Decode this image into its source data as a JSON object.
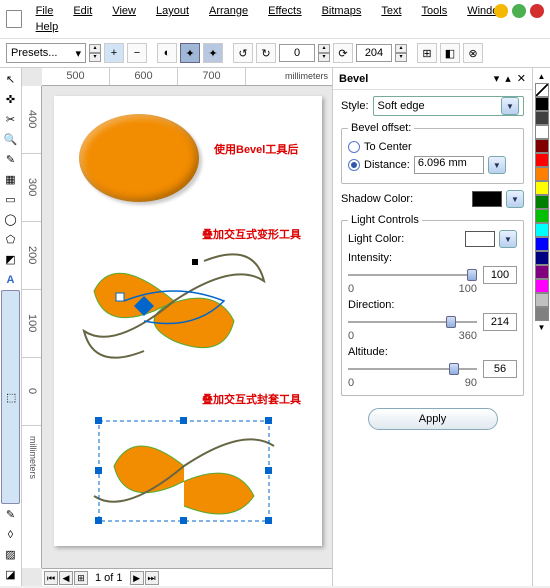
{
  "menu": {
    "items": [
      "File",
      "Edit",
      "View",
      "Layout",
      "Arrange",
      "Effects",
      "Bitmaps",
      "Text",
      "Tools",
      "Window",
      "Help"
    ]
  },
  "toolbar": {
    "presets": "Presets...",
    "rot": "0",
    "copies": "204"
  },
  "ruler": {
    "h": [
      "500",
      "600",
      "700"
    ],
    "v": [
      "400",
      "300",
      "200",
      "100",
      "0"
    ],
    "units": "millimeters",
    "vunits": "millimeters"
  },
  "annot": {
    "a1": "使用Bevel工具后",
    "a2": "叠加交互式变形工具",
    "a3": "叠加交互式封套工具"
  },
  "pagebar": {
    "label": "1 of 1"
  },
  "bevel": {
    "title": "Bevel",
    "style_lbl": "Style:",
    "style_val": "Soft edge",
    "offset_lbl": "Bevel offset:",
    "to_center": "To Center",
    "distance_lbl": "Distance:",
    "distance_val": "6.096 mm",
    "shadow_lbl": "Shadow Color:",
    "light_legend": "Light Controls",
    "light_color": "Light Color:",
    "intensity": "Intensity:",
    "int_val": "100",
    "int_min": "0",
    "int_max": "100",
    "direction": "Direction:",
    "dir_val": "214",
    "dir_min": "0",
    "dir_max": "360",
    "altitude": "Altitude:",
    "alt_val": "56",
    "alt_min": "0",
    "alt_max": "90",
    "apply": "Apply"
  },
  "palette": [
    "#000000",
    "#404040",
    "#ffffff",
    "#800000",
    "#ff0000",
    "#ff8000",
    "#ffff00",
    "#008000",
    "#00c000",
    "#00ffff",
    "#0000ff",
    "#000080",
    "#800080",
    "#ff00ff",
    "#c0c0c0",
    "#808080"
  ]
}
